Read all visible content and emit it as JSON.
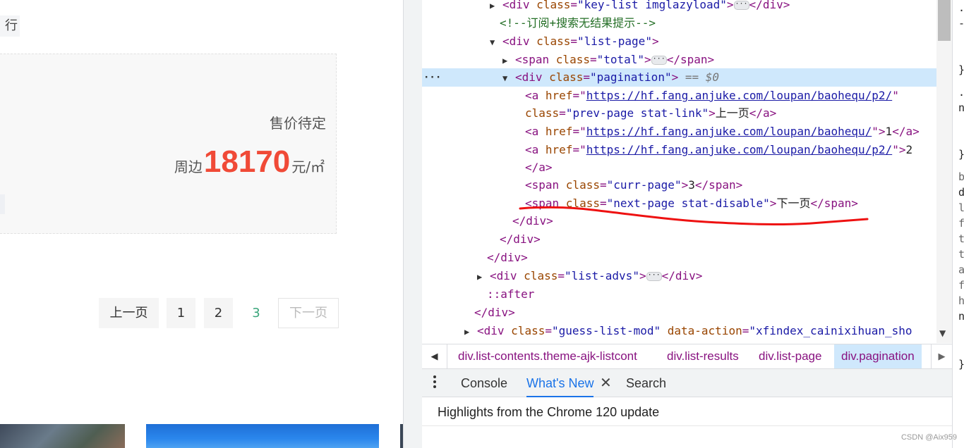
{
  "page": {
    "nav_fragment": "行",
    "status_label": "售价待定",
    "price_prefix": "周边",
    "price_value": "18170",
    "price_unit": "元/㎡",
    "pager": {
      "prev": "上一页",
      "p1": "1",
      "p2": "2",
      "p3": "3",
      "next": "下一页"
    }
  },
  "devtools": {
    "lines": {
      "l0": {
        "open": "<div ",
        "attr": "class",
        "val": "\"key-list imglazyload\"",
        "close": "</div>"
      },
      "l1": {
        "comment": "<!--订阅+搜索无结果提示-->"
      },
      "l2": {
        "open": "<div ",
        "attr": "class",
        "val": "\"list-page\"",
        "end": ">"
      },
      "l3": {
        "open": "<span ",
        "attr": "class",
        "val": "\"total\"",
        "close": "</span>"
      },
      "l4": {
        "open": "<div ",
        "attr": "class",
        "val": "\"pagination\"",
        "end": ">",
        "marker": " == $0"
      },
      "l5": {
        "open": "<a ",
        "attr": "href",
        "link": "https://hf.fang.anjuke.com/loupan/baohequ/p2/",
        "q": "\""
      },
      "l6": {
        "attr": "class",
        "val": "\"prev-page stat-link\"",
        "text": "上一页",
        "close": "</a>"
      },
      "l7": {
        "open": "<a ",
        "attr": "href",
        "link": "https://hf.fang.anjuke.com/loupan/baohequ/",
        "text": "1",
        "close": "</a>"
      },
      "l8": {
        "open": "<a ",
        "attr": "href",
        "link": "https://hf.fang.anjuke.com/loupan/baohequ/p2/",
        "text": "2"
      },
      "l9": {
        "close": "</a>"
      },
      "l10": {
        "open": "<span ",
        "attr": "class",
        "val": "\"curr-page\"",
        "text": "3",
        "close": "</span>"
      },
      "l11": {
        "open": "<span ",
        "attr": "class",
        "val": "\"next-page stat-disable\"",
        "text": "下一页",
        "close": "</span>"
      },
      "l12": {
        "close": "</div>"
      },
      "l13": {
        "close": "</div>"
      },
      "l14": {
        "close": "</div>"
      },
      "l15": {
        "open": "<div ",
        "attr": "class",
        "val": "\"list-advs\"",
        "close": "</div>"
      },
      "l16": {
        "pseudo": "::after"
      },
      "l17": {
        "close": "</div>"
      },
      "l18": {
        "open": "<div ",
        "attr": "class",
        "val": "\"guess-list-mod\"",
        "attr2": "data-action",
        "val2": "\"xfindex_cainixihuan_sho"
      }
    },
    "gutter_ellipsis": "···",
    "breadcrumbs": [
      "div.list-contents.theme-ajk-listcont",
      "div.list-results",
      "div.list-page",
      "div.pagination"
    ],
    "drawer_tabs": {
      "console": "Console",
      "whats_new": "What's New",
      "search": "Search"
    },
    "drawer_close": "✕",
    "highlights": "Highlights from the Chrome 120 update",
    "watermark": "CSDN @Aix959",
    "styles_glyphs": [
      ".",
      "-",
      "}",
      ".",
      "n",
      "}",
      "b",
      "d",
      "l",
      "f",
      "t",
      "t",
      "a",
      "f",
      "h",
      "n",
      "}"
    ]
  },
  "colors": {
    "price": "#f04a37",
    "current_page": "#3aa57b",
    "selection": "#cfe8fc",
    "annotation": "#ee1111"
  }
}
